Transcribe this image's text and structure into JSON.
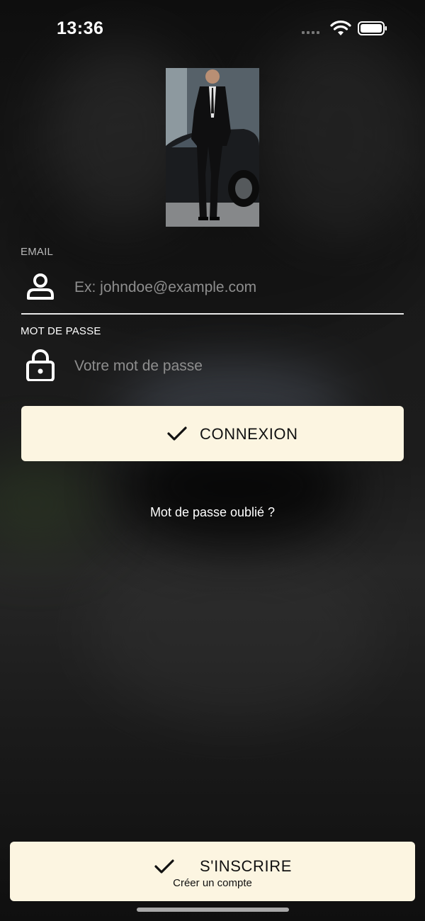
{
  "status_bar": {
    "time": "13:36"
  },
  "hero_image": {
    "subject": "man in black suit beside black sports car"
  },
  "form": {
    "email": {
      "label": "EMAIL",
      "placeholder": "Ex: johndoe@example.com",
      "value": "",
      "icon": "user-icon"
    },
    "password": {
      "label": "MOT DE PASSE",
      "placeholder": "Votre mot de passe",
      "value": "",
      "icon": "lock-icon"
    }
  },
  "login_button": {
    "label": "CONNEXION",
    "icon": "check-icon"
  },
  "forgot_password": {
    "label": "Mot de passe oublié ?"
  },
  "signup_button": {
    "label": "S'INSCRIRE",
    "sublabel": "Créer un compte",
    "icon": "check-icon"
  },
  "colors": {
    "button_background": "#fcf5e1",
    "button_text": "#111111",
    "text": "#ffffff",
    "placeholder": "#8e8e8e"
  }
}
